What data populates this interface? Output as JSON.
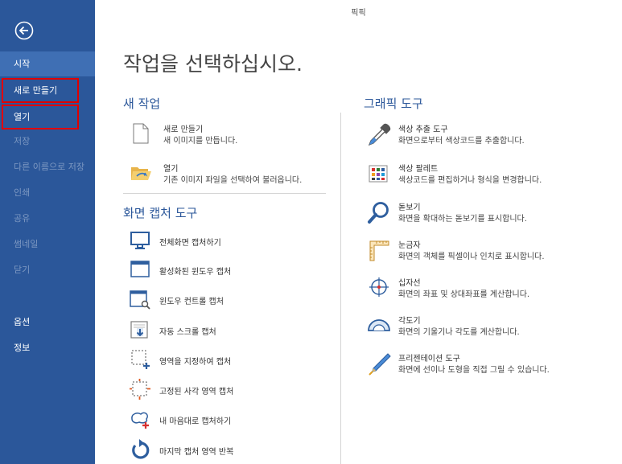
{
  "window": {
    "title": "픽픽"
  },
  "sidebar": {
    "items": [
      {
        "label": "시작",
        "state": "active"
      },
      {
        "label": "새로 만들기",
        "state": "enabled"
      },
      {
        "label": "열기",
        "state": "enabled"
      },
      {
        "label": "저장",
        "state": "disabled"
      },
      {
        "label": "다른 이름으로 저장",
        "state": "disabled"
      },
      {
        "label": "인쇄",
        "state": "disabled"
      },
      {
        "label": "공유",
        "state": "disabled"
      },
      {
        "label": "썸네일",
        "state": "disabled"
      },
      {
        "label": "닫기",
        "state": "disabled"
      },
      {
        "label": "옵션",
        "state": "enabled"
      },
      {
        "label": "정보",
        "state": "enabled"
      }
    ]
  },
  "main": {
    "title": "작업을 선택하십시오.",
    "new_task": {
      "title": "새 작업",
      "items": [
        {
          "title": "새로 만들기",
          "desc": "새 이미지를 만듭니다.",
          "icon": "new-file-icon"
        },
        {
          "title": "열기",
          "desc": "기존 이미지 파일을 선택하여 불러옵니다.",
          "icon": "open-folder-icon"
        }
      ]
    },
    "capture": {
      "title": "화면 캡처 도구",
      "items": [
        {
          "label": "전체화면 캡처하기",
          "icon": "monitor-icon"
        },
        {
          "label": "활성화된 윈도우 캡처",
          "icon": "window-icon"
        },
        {
          "label": "윈도우 컨트롤 캡처",
          "icon": "window-control-icon"
        },
        {
          "label": "자동 스크롤 캡처",
          "icon": "scroll-capture-icon"
        },
        {
          "label": "영역을 지정하여 캡처",
          "icon": "region-icon"
        },
        {
          "label": "고정된 사각 영역 캡처",
          "icon": "fixed-region-icon"
        },
        {
          "label": "내 마음대로 캡처하기",
          "icon": "freehand-icon"
        },
        {
          "label": "마지막 캡처 영역 반복",
          "icon": "repeat-icon"
        }
      ]
    },
    "graphics": {
      "title": "그래픽 도구",
      "items": [
        {
          "title": "색상 추출 도구",
          "desc": "화면으로부터 색상코드를 추출합니다.",
          "icon": "eyedropper-icon"
        },
        {
          "title": "색상 팔레트",
          "desc": "색상코드를 편집하거나 형식을 변경합니다.",
          "icon": "palette-icon"
        },
        {
          "title": "돋보기",
          "desc": "화면을 확대하는 돋보기를 표시합니다.",
          "icon": "magnifier-icon"
        },
        {
          "title": "눈금자",
          "desc": "화면의 객체를 픽셀이나 인치로 표시합니다.",
          "icon": "ruler-icon"
        },
        {
          "title": "십자선",
          "desc": "화면의 좌표 및 상대좌표를 계산합니다.",
          "icon": "crosshair-icon"
        },
        {
          "title": "각도기",
          "desc": "화면의 기울기나 각도를 계산합니다.",
          "icon": "protractor-icon"
        },
        {
          "title": "프리젠테이션 도구",
          "desc": "화면에 선이나 도형을 직접 그릴 수 있습니다.",
          "icon": "pen-icon"
        }
      ]
    }
  },
  "colors": {
    "sidebar": "#2b579a",
    "accent": "#2b579a",
    "highlight": "#e00000"
  }
}
